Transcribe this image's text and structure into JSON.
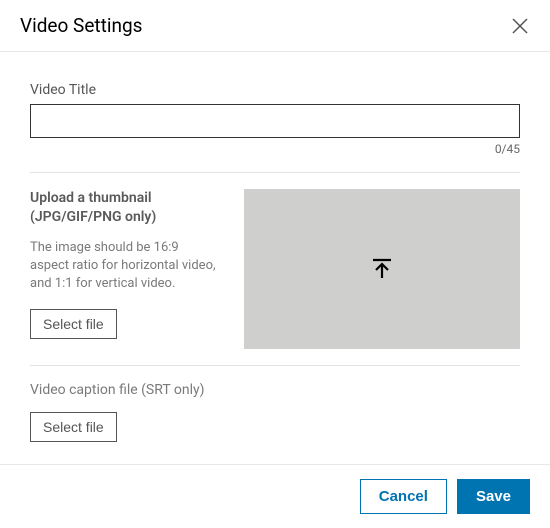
{
  "header": {
    "title": "Video Settings"
  },
  "videoTitle": {
    "label": "Video Title",
    "value": "",
    "counter": "0/45"
  },
  "thumbnail": {
    "title": "Upload a thumbnail (JPG/GIF/PNG only)",
    "description": "The image should be 16:9 aspect ratio for horizontal video, and 1:1 for vertical video.",
    "selectButton": "Select file"
  },
  "caption": {
    "label": "Video caption file (SRT only)",
    "selectButton": "Select file"
  },
  "footer": {
    "cancel": "Cancel",
    "save": "Save"
  }
}
